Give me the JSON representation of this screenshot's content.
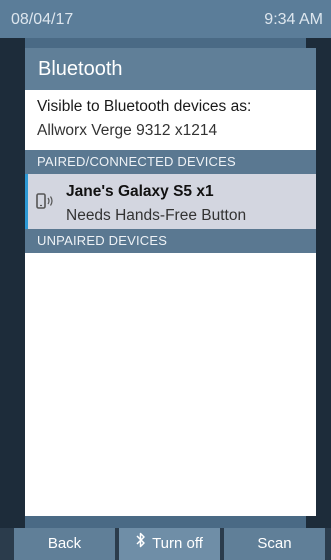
{
  "status_bar": {
    "date": "08/04/17",
    "time": "9:34 AM"
  },
  "screen": {
    "title": "Bluetooth",
    "visible_label": "Visible to Bluetooth devices as:",
    "visible_name": "Allworx Verge 9312 x1214"
  },
  "sections": {
    "paired_header": "PAIRED/CONNECTED DEVICES",
    "unpaired_header": "UNPAIRED DEVICES"
  },
  "paired_devices": [
    {
      "name": "Jane's Galaxy S5 x1",
      "status": "Needs Hands-Free Button",
      "icon": "phone-bluetooth-icon"
    }
  ],
  "softkeys": {
    "back": "Back",
    "turn_off": "Turn off",
    "scan": "Scan"
  },
  "colors": {
    "accent": "#2c98d4",
    "header": "#607f98",
    "selected_row": "#d3d6e0"
  }
}
